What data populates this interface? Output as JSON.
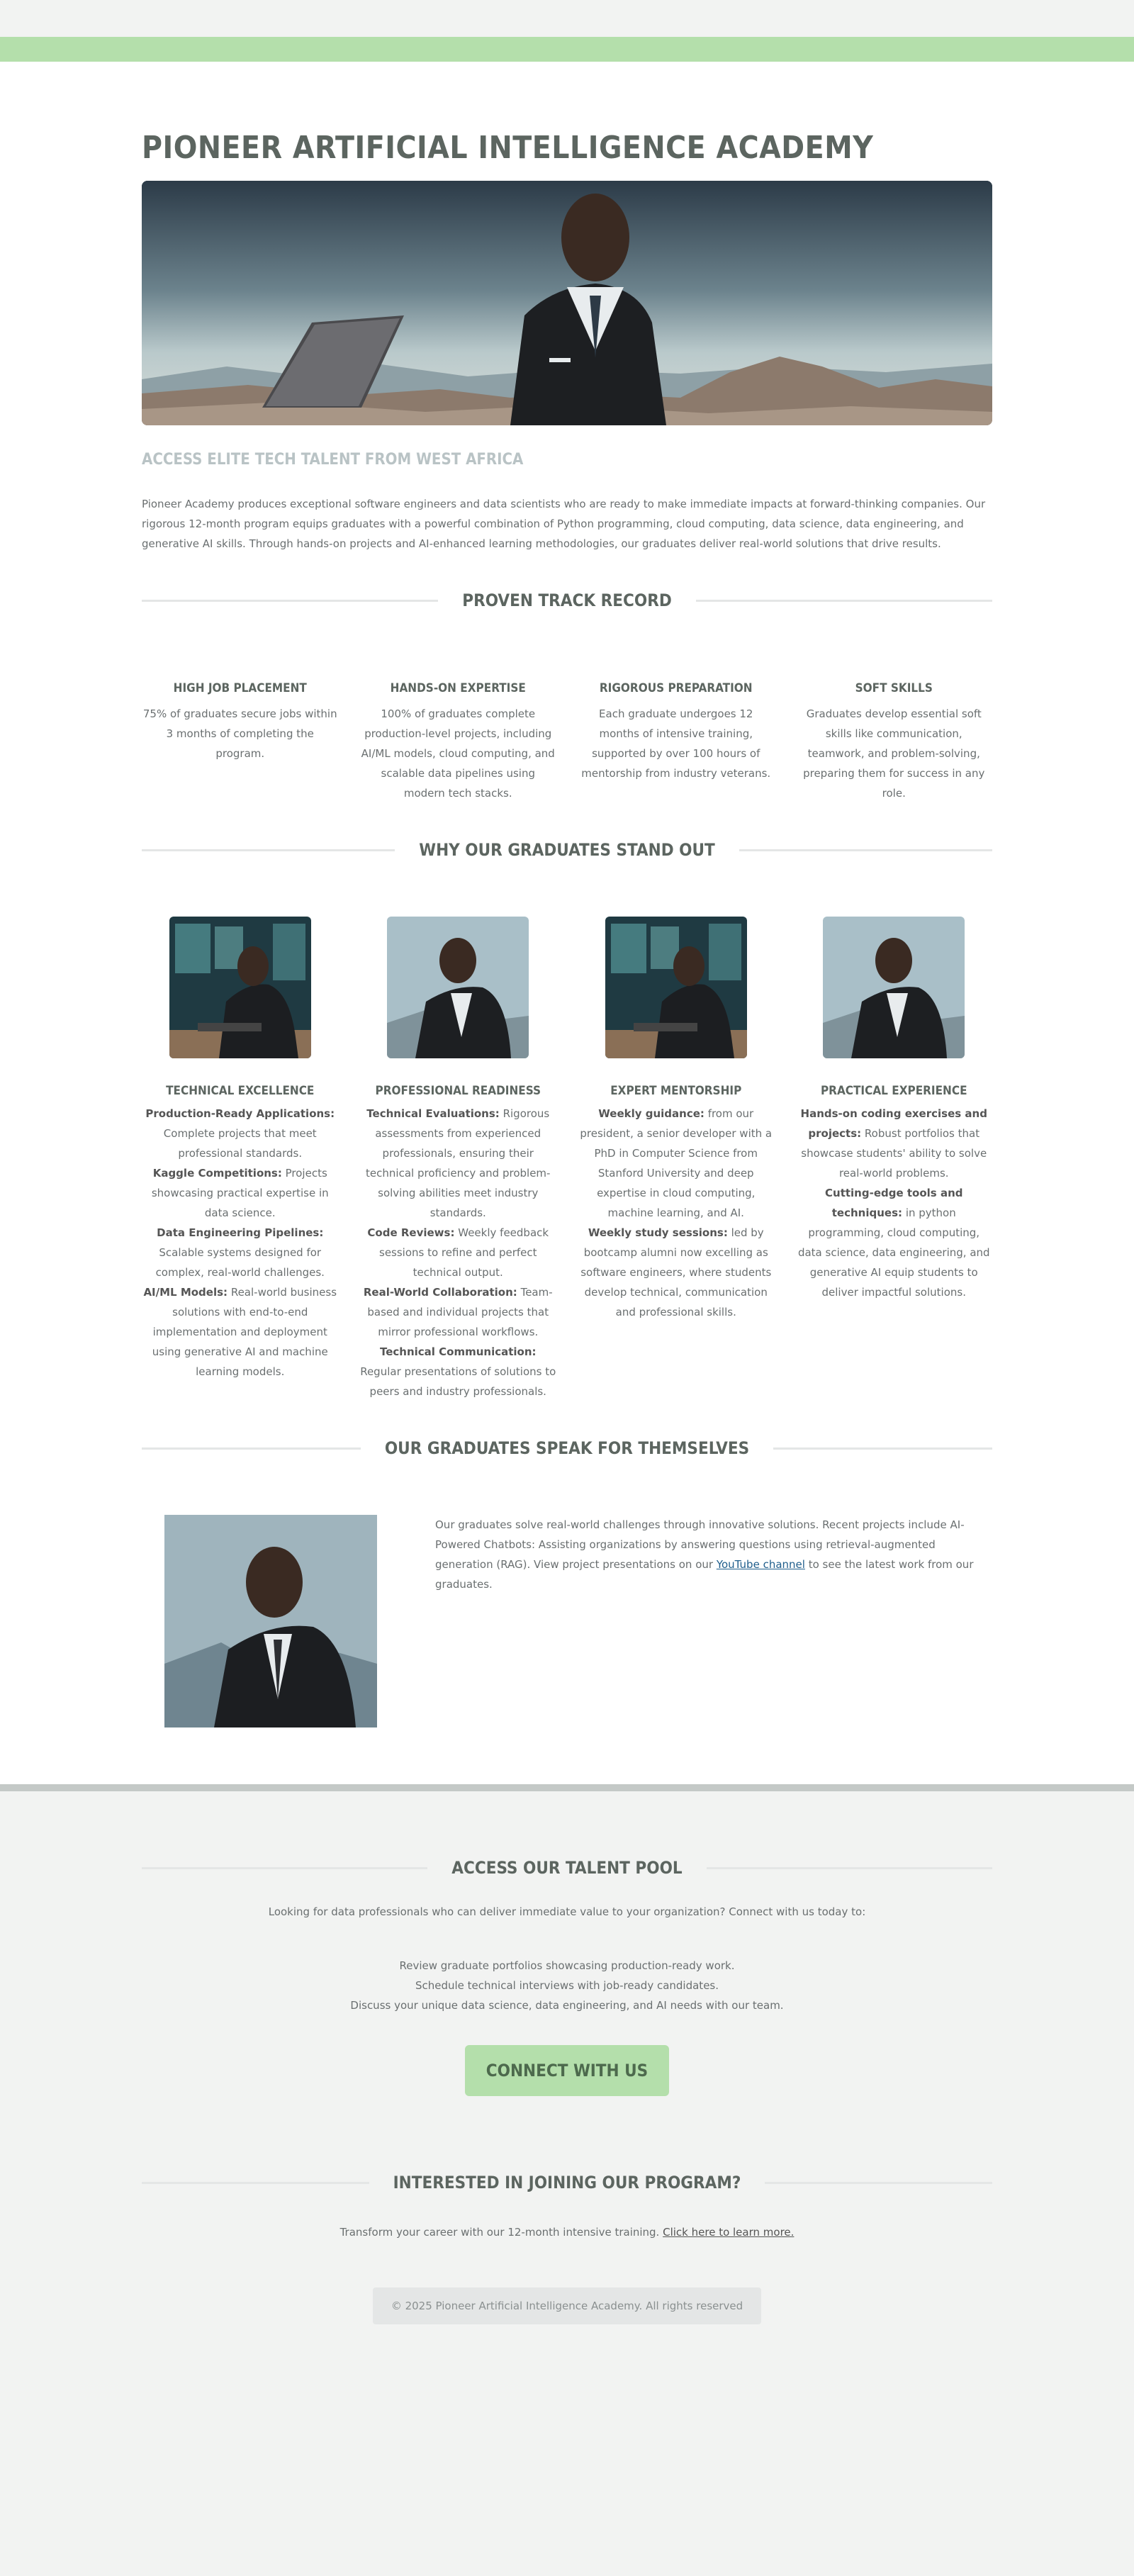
{
  "site": {
    "title": "PIONEER ARTIFICIAL INTELLIGENCE ACADEMY",
    "tagline": "ACCESS ELITE TECH TALENT FROM WEST AFRICA",
    "intro": "Pioneer Academy produces exceptional software engineers and data scientists who are ready to make immediate impacts at forward-thinking companies. Our rigorous 12-month program equips graduates with a powerful combination of Python programming, cloud computing, data science, data engineering, and generative AI skills. Through hands-on projects and AI-enhanced learning methodologies, our graduates deliver real-world solutions that drive results."
  },
  "track_record": {
    "heading": "PROVEN TRACK RECORD",
    "stats": [
      {
        "title": "HIGH JOB PLACEMENT",
        "text": "75% of graduates secure jobs within 3 months of completing the program."
      },
      {
        "title": "HANDS-ON EXPERTISE",
        "text": "100% of graduates complete production-level projects, including AI/ML models, cloud computing, and scalable data pipelines using modern tech stacks."
      },
      {
        "title": "RIGOROUS PREPARATION",
        "text": "Each graduate undergoes 12 months of intensive training, supported by over 100 hours of mentorship from industry veterans."
      },
      {
        "title": "SOFT SKILLS",
        "text": "Graduates develop essential soft skills like communication, teamwork, and problem-solving, preparing them for success in any role."
      }
    ]
  },
  "stand_out": {
    "heading": "WHY OUR GRADUATES STAND OUT",
    "features": [
      {
        "title": "TECHNICAL EXCELLENCE",
        "items": [
          {
            "label": "Production-Ready Applications:",
            "text": "Complete projects that meet professional standards."
          },
          {
            "label": "Kaggle Competitions:",
            "text": "Projects showcasing practical expertise in data science."
          },
          {
            "label": "Data Engineering Pipelines:",
            "text": "Scalable systems designed for complex, real-world challenges."
          },
          {
            "label": "AI/ML Models:",
            "text": "Real-world business solutions with end-to-end implementation and deployment using generative AI and machine learning models."
          }
        ]
      },
      {
        "title": "PROFESSIONAL READINESS",
        "items": [
          {
            "label": "Technical Evaluations:",
            "text": "Rigorous assessments from experienced professionals, ensuring their technical proficiency and problem-solving abilities meet industry standards."
          },
          {
            "label": "Code Reviews:",
            "text": "Weekly feedback sessions to refine and perfect technical output."
          },
          {
            "label": "Real-World Collaboration:",
            "text": "Team-based and individual projects that mirror professional workflows."
          },
          {
            "label": "Technical Communication:",
            "text": "Regular presentations of solutions to peers and industry professionals."
          }
        ]
      },
      {
        "title": "EXPERT MENTORSHIP",
        "items": [
          {
            "label": "Weekly guidance:",
            "text": "from our president, a senior developer with a PhD in Computer Science from Stanford University and deep expertise in cloud computing, machine learning, and AI."
          },
          {
            "label": "Weekly study sessions:",
            "text": "led by bootcamp alumni now excelling as software engineers, where students develop technical, communication and professional skills."
          }
        ]
      },
      {
        "title": "PRACTICAL EXPERIENCE",
        "items": [
          {
            "label": "Hands-on coding exercises and projects:",
            "text": "Robust portfolios that showcase students' ability to solve real-world problems."
          },
          {
            "label": "Cutting-edge tools and techniques:",
            "text": "in python programming, cloud computing, data science, data engineering, and generative AI equip students to deliver impactful solutions."
          }
        ]
      }
    ]
  },
  "testimonial": {
    "heading": "OUR GRADUATES SPEAK FOR THEMSELVES",
    "text_before": "Our graduates solve real-world challenges through innovative solutions. Recent projects include AI-Powered Chatbots: Assisting organizations by answering questions using retrieval-augmented generation (RAG). View project presentations on our ",
    "link_text": "YouTube channel",
    "text_after": " to see the latest work from our graduates."
  },
  "talent_pool": {
    "heading": "ACCESS OUR TALENT POOL",
    "lead": "Looking for data professionals who can deliver immediate value to your organization? Connect with us today to:",
    "bullets": [
      "Review graduate portfolios showcasing production-ready work.",
      "Schedule technical interviews with job-ready candidates.",
      "Discuss your unique data science, data engineering, and AI needs with our team."
    ],
    "cta_label": "CONNECT WITH US"
  },
  "join": {
    "heading": "INTERESTED IN JOINING OUR PROGRAM?",
    "text": "Transform your career with our 12-month intensive training. ",
    "link_text": "Click here to learn more."
  },
  "footer": {
    "copyright": "© 2025 Pioneer Artificial Intelligence Academy. All rights reserved"
  },
  "colors": {
    "accent_green": "#b4dfab",
    "heading_gray": "#5c6560",
    "link_blue": "#1f5e8c"
  }
}
